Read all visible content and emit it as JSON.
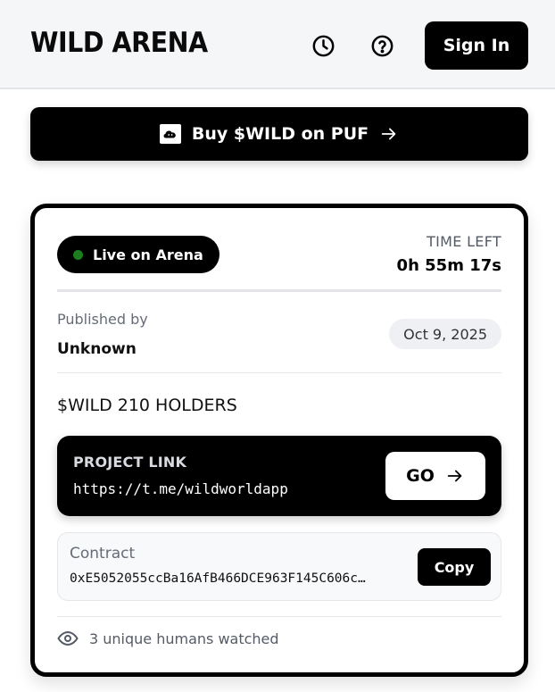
{
  "header": {
    "title": "WILD ARENA",
    "history_icon": "clock-icon",
    "help_icon": "question-circle-icon",
    "signin_label": "Sign In"
  },
  "banner": {
    "logo_icon": "puf-logo-icon",
    "label": "Buy $WILD on PUF",
    "arrow_icon": "arrow-right-icon"
  },
  "card": {
    "status": {
      "label": "Live on Arena",
      "dot_color": "#1c7d1f"
    },
    "time_left": {
      "label": "TIME LEFT",
      "value": "0h 55m 17s"
    },
    "published": {
      "label": "Published by",
      "publisher": "Unknown",
      "date": "Oct 9, 2025"
    },
    "holders": "$WILD 210 HOLDERS",
    "project": {
      "label": "PROJECT LINK",
      "url": "https://t.me/wildworldapp",
      "go_label": "GO"
    },
    "contract": {
      "label": "Contract",
      "address": "0xE5052055ccBa16AfB466DCE963F145C606c…",
      "copy_label": "Copy"
    },
    "watchers": {
      "icon": "eye-icon",
      "text": "3 unique humans watched"
    }
  },
  "colors": {
    "accent": "#000000",
    "header_bg": "#f5f6f8",
    "live": "#1c7d1f"
  }
}
